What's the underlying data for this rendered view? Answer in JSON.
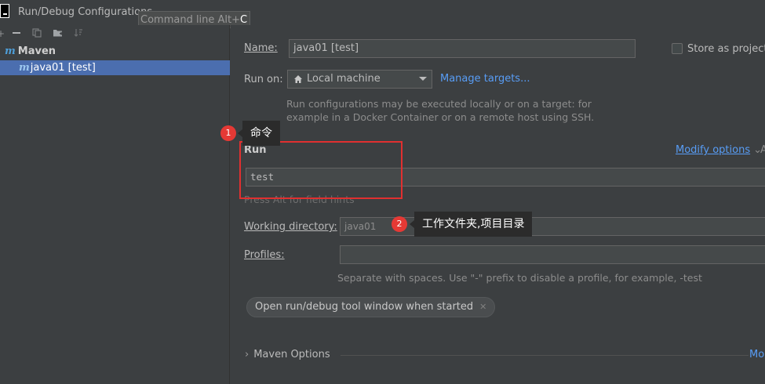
{
  "window": {
    "title": "Run/Debug Configurations",
    "tooltip_text": "Command line Alt+",
    "tooltip_key": "C"
  },
  "toolbar": {
    "icons": [
      "add-icon",
      "remove-icon",
      "copy-icon",
      "folder-add-icon",
      "sort-icon"
    ]
  },
  "tree": {
    "group_label": "Maven",
    "group_icon": "m",
    "selected_item": "java01 [test]",
    "item_icon": "m"
  },
  "form": {
    "name_label": "Name:",
    "name_value": "java01 [test]",
    "store_label": "Store as project f",
    "run_on_label": "Run on:",
    "run_on_value": "Local machine",
    "manage_targets": "Manage targets...",
    "run_on_hint_1": "Run configurations may be executed locally or on a target: for",
    "run_on_hint_2": "example in a Docker Container or on a remote host using SSH.",
    "run_section": "Run",
    "modify_options": "Modify options",
    "command_value": "test",
    "field_hint": "Press Alt for field hints",
    "working_dir_label": "Working directory:",
    "working_dir_value": "java01",
    "profiles_label": "Profiles:",
    "profiles_value": "",
    "profiles_hint": "Separate with spaces. Use \"-\" prefix to disable a profile, for example, -test",
    "chip_label": "Open run/debug tool window when started",
    "maven_options": "Maven Options",
    "more_link": "Mo"
  },
  "annotations": {
    "badge1": "1",
    "callout1": "命令",
    "badge2": "2",
    "callout2": "工作文件夹,项目目录"
  },
  "colors": {
    "accent_link": "#589df6",
    "selection": "#4b6eaf",
    "annotation_red": "#e53935"
  }
}
